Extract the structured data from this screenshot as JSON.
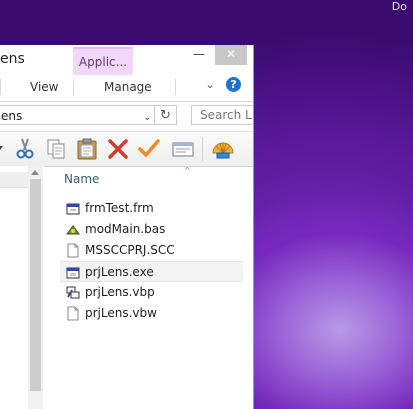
{
  "desktop": {
    "corner_text": "Do"
  },
  "window": {
    "title_fragment": "ens",
    "contextual_tab": "Applic...",
    "minimize_glyph": "—",
    "close_glyph": "✕",
    "ribbon_tabs": [
      "View",
      "Manage"
    ],
    "expand_glyph": "⌄",
    "help_glyph": "?"
  },
  "address": {
    "path_fragment": "ens",
    "dropdown_glyph": "⌄",
    "refresh_glyph": "↻",
    "search_placeholder": "Search L"
  },
  "toolbar": {
    "icons": [
      "cut-icon",
      "copy-icon",
      "paste-icon",
      "delete-icon",
      "checkmark-icon",
      "properties-icon",
      "shell-icon"
    ]
  },
  "file_list": {
    "column_header": "Name",
    "sort_glyph": "^",
    "items": [
      {
        "name": "frmTest.frm",
        "icon": "vb-form-icon"
      },
      {
        "name": "modMain.bas",
        "icon": "vb-module-icon"
      },
      {
        "name": "MSSCCPRJ.SCC",
        "icon": "blank-file-icon"
      },
      {
        "name": "prjLens.exe",
        "icon": "exe-icon",
        "selected": true
      },
      {
        "name": "prjLens.vbp",
        "icon": "vb-project-icon"
      },
      {
        "name": "prjLens.vbw",
        "icon": "blank-file-icon"
      }
    ]
  },
  "colors": {
    "accent": "#1a73d0",
    "contextual_tab_bg": "#f2d7f9",
    "selection_bg": "#f3f3f3",
    "header_text": "#3b5a84"
  }
}
